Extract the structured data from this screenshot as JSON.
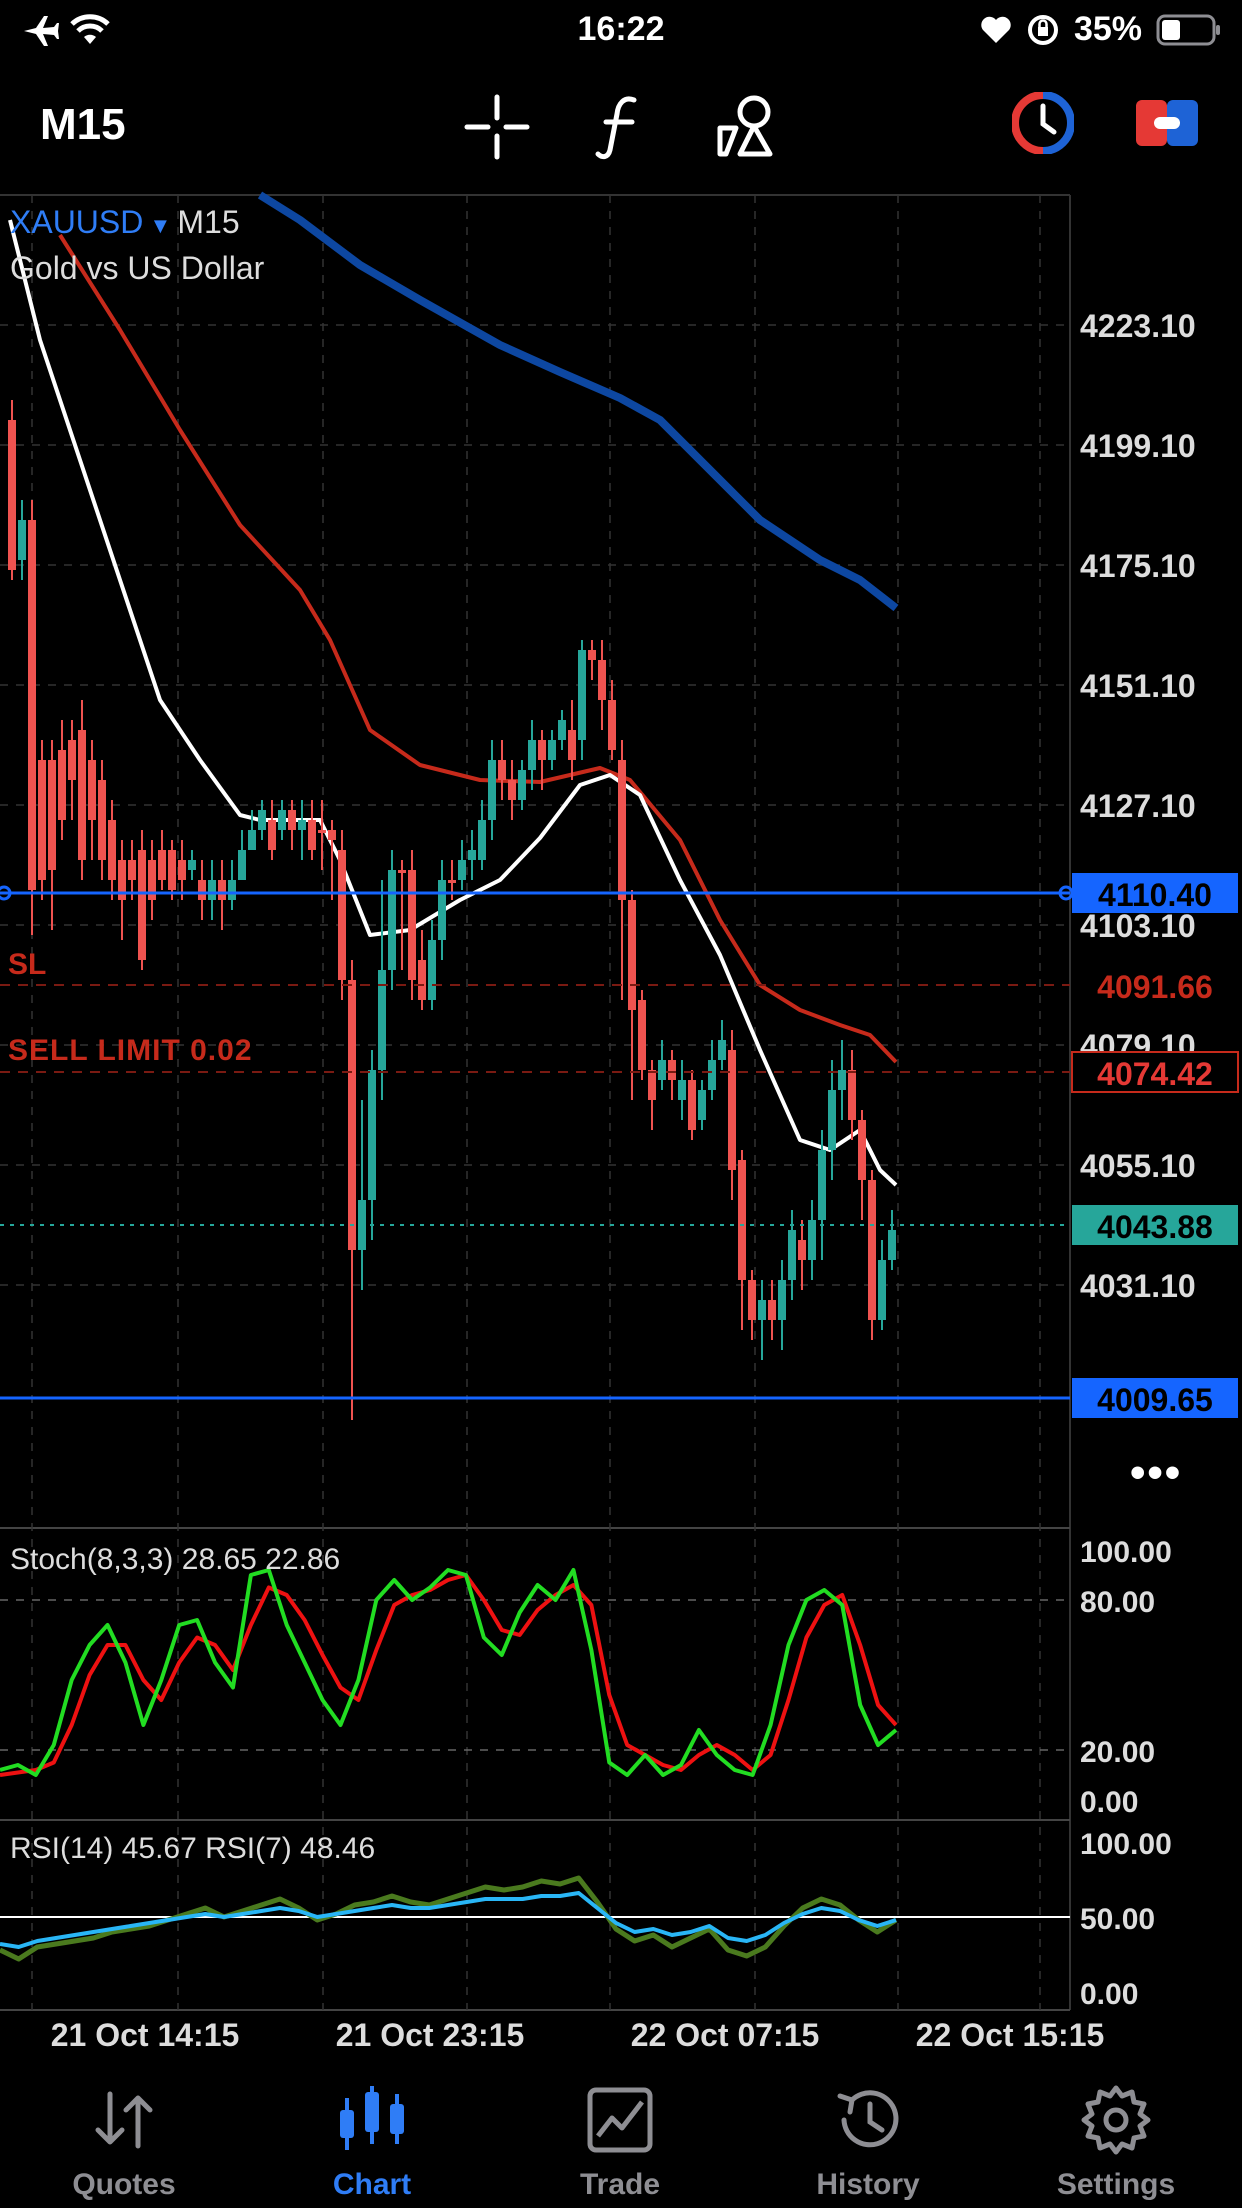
{
  "status_bar": {
    "time": "16:22",
    "battery": "35%"
  },
  "toolbar": {
    "timeframe": "M15"
  },
  "chart_info": {
    "symbol": "XAUUSD",
    "timeframe": "M15",
    "description": "Gold vs US Dollar"
  },
  "price_axis": [
    "4223.10",
    "4199.10",
    "4175.10",
    "4151.10",
    "4127.10",
    "4103.10",
    "4079.10",
    "4055.10",
    "4031.10"
  ],
  "price_tags": {
    "line1": "4110.40",
    "sl": "4091.66",
    "sell_limit": "4074.42",
    "bid": "4043.88",
    "line2": "4009.65"
  },
  "order_labels": {
    "sl": "SL",
    "sell_limit": "SELL LIMIT 0.02"
  },
  "stoch": {
    "label": "Stoch(8,3,3) 28.65 22.86",
    "levels": [
      "100.00",
      "80.00",
      "20.00",
      "0.00"
    ]
  },
  "rsi": {
    "label": "RSI(14) 45.67 RSI(7) 48.46",
    "levels": [
      "100.00",
      "50.00",
      "0.00"
    ]
  },
  "time_axis": [
    "21 Oct 14:15",
    "21 Oct 23:15",
    "22 Oct 07:15",
    "22 Oct 15:15"
  ],
  "tabs": [
    {
      "label": "Quotes",
      "icon": "quotes-icon"
    },
    {
      "label": "Chart",
      "icon": "chart-icon"
    },
    {
      "label": "Trade",
      "icon": "trade-icon"
    },
    {
      "label": "History",
      "icon": "history-icon"
    },
    {
      "label": "Settings",
      "icon": "settings-icon"
    }
  ],
  "colors": {
    "up": "#26a69a",
    "down": "#ef5350",
    "ma_fast": "#ffffff",
    "ma_mid": "#c62a1b",
    "ma_slow": "#0d47a1",
    "line_blue": "#1565ff",
    "stoch_k": "#22dd22",
    "stoch_d": "#ee1111",
    "rsi14": "#29b6f6",
    "rsi7": "#4a7a1e",
    "accent": "#2f7df6"
  }
}
